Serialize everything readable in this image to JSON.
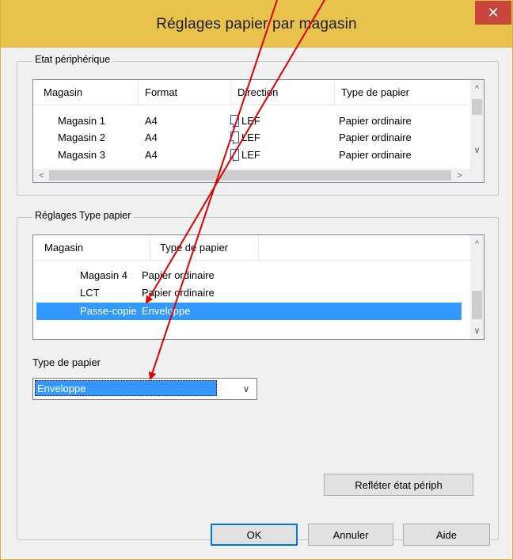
{
  "window": {
    "title": "Réglages papier par magasin",
    "close_glyph": "✕",
    "titlebar_color": "#e8c24a",
    "close_color": "#c7453a"
  },
  "device_state": {
    "group_label": "Etat périphérique",
    "columns": [
      "Magasin",
      "Format",
      "Direction",
      "Type de papier"
    ],
    "rows": [
      {
        "tray": "Magasin 1",
        "format": "A4",
        "direction": "LEF",
        "paper_type": "Papier ordinaire"
      },
      {
        "tray": "Magasin 2",
        "format": "A4",
        "direction": "LEF",
        "paper_type": "Papier ordinaire"
      },
      {
        "tray": "Magasin 3",
        "format": "A4",
        "direction": "LEF",
        "paper_type": "Papier ordinaire"
      }
    ]
  },
  "paper_settings": {
    "group_label": "Réglages Type papier",
    "columns": [
      "Magasin",
      "Type de papier"
    ],
    "rows": [
      {
        "tray": "Magasin 4",
        "paper_type": "Papier ordinaire",
        "selected": false
      },
      {
        "tray": "LCT",
        "paper_type": "Papier ordinaire",
        "selected": false
      },
      {
        "tray": "Passe-copie",
        "paper_type": "Enveloppe",
        "selected": true
      }
    ],
    "selection_color": "#3399ff"
  },
  "paper_type_field": {
    "label": "Type de papier",
    "value": "Enveloppe"
  },
  "buttons": {
    "reflect": "Refléter état périph",
    "ok": "OK",
    "cancel": "Annuler",
    "help": "Aide"
  },
  "annotation_color": "#e00000"
}
